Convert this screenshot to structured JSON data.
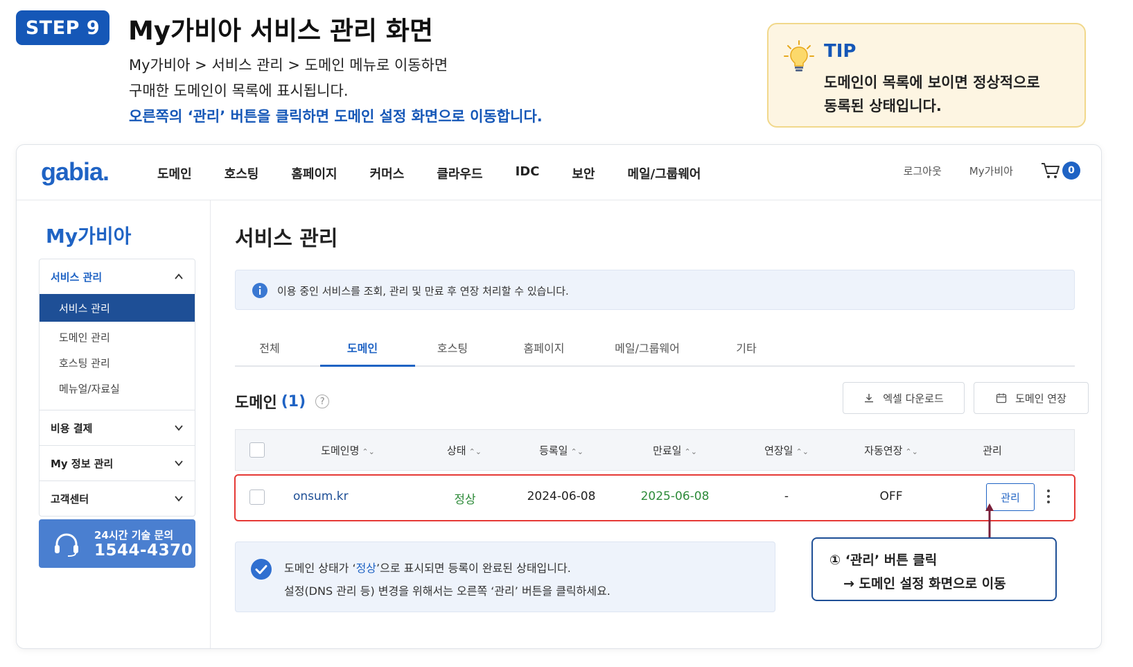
{
  "header": {
    "step_label": "STEP 9",
    "title": "My가비아 서비스 관리 화면",
    "desc_line1": "My가비아 > 서비스 관리 > 도메인 메뉴로 이동하면",
    "desc_line2": "구매한 도메인이 목록에 표시됩니다.",
    "desc_line3": "오른쪽의 ‘관리’ 버튼을 클릭하면 도메인 설정 화면으로 이동합니다."
  },
  "tip": {
    "icon": "lightbulb-icon",
    "title": "TIP",
    "line1": "도메인이 목록에 보이면 정상적으로",
    "line2": "동록된 상태입니다."
  },
  "gnb": {
    "logo": "gabia.",
    "menu": [
      "도메인",
      "호스팅",
      "홈페이지",
      "커머스",
      "클라우드",
      "IDC",
      "보안",
      "메일/그룹웨어"
    ],
    "logout": "로그아웃",
    "my_gabia": "My가비아",
    "cart_icon": "cart-icon",
    "cart_count": "0"
  },
  "lnb": {
    "title": "My가비아",
    "groups": [
      {
        "label": "서비스 관리",
        "expanded": true,
        "items": [
          "서비스 관리",
          "도메인 관리",
          "호스팅 관리",
          "메뉴얼/자료실"
        ],
        "active_item": "서비스 관리"
      },
      {
        "label": "비용 결제",
        "expanded": false
      },
      {
        "label": "My 정보 관리",
        "expanded": false
      },
      {
        "label": "고객센터",
        "expanded": false
      }
    ],
    "support": {
      "icon": "headset-icon",
      "label": "24시간 기술 문의",
      "phone": "1544-4370"
    }
  },
  "main": {
    "page_title": "서비스 관리",
    "notice": "이용 중인 서비스를 조회, 관리 및 만료 후 연장 처리할 수 있습니다.",
    "tabs": [
      "전체",
      "도메인",
      "호스팅",
      "홈페이지",
      "메일/그룹웨어",
      "기타"
    ],
    "active_tab": "도메인",
    "section_title": "도메인",
    "section_count": "(1)",
    "help": "?",
    "excel_button": "엑셀 다운로드",
    "renew_button": "도메인 연장",
    "table": {
      "columns": [
        "도메인명",
        "상태",
        "등록일",
        "만료일",
        "연장일",
        "자동연장",
        "관리"
      ],
      "rows": [
        {
          "domain": "onsum.kr",
          "status": "정상",
          "registered": "2024-06-08",
          "expires": "2025-06-08",
          "renewed": "-",
          "auto_renew": "OFF",
          "manage": "관리"
        }
      ]
    },
    "callout": {
      "line1": "① ‘관리’ 버튼 클릭",
      "line2": "→ 도메인 설정 화면으로 이동"
    },
    "info": {
      "line1_pre": "도메인 상태가 ‘",
      "line1_hl": "정상",
      "line1_post": "’으로 표시되면 등록이 완료된 상태입니다.",
      "line2": "설정(DNS 관리 등) 변경을 위해서는 오른쪽 ‘관리’ 버튼을 클릭하세요."
    }
  },
  "colors": {
    "brand_blue": "#1f63c4",
    "active_nav": "#1e4f96",
    "highlight_red": "#e53935",
    "status_green": "#2e8b3a",
    "tip_bg": "#fdf5e2"
  }
}
